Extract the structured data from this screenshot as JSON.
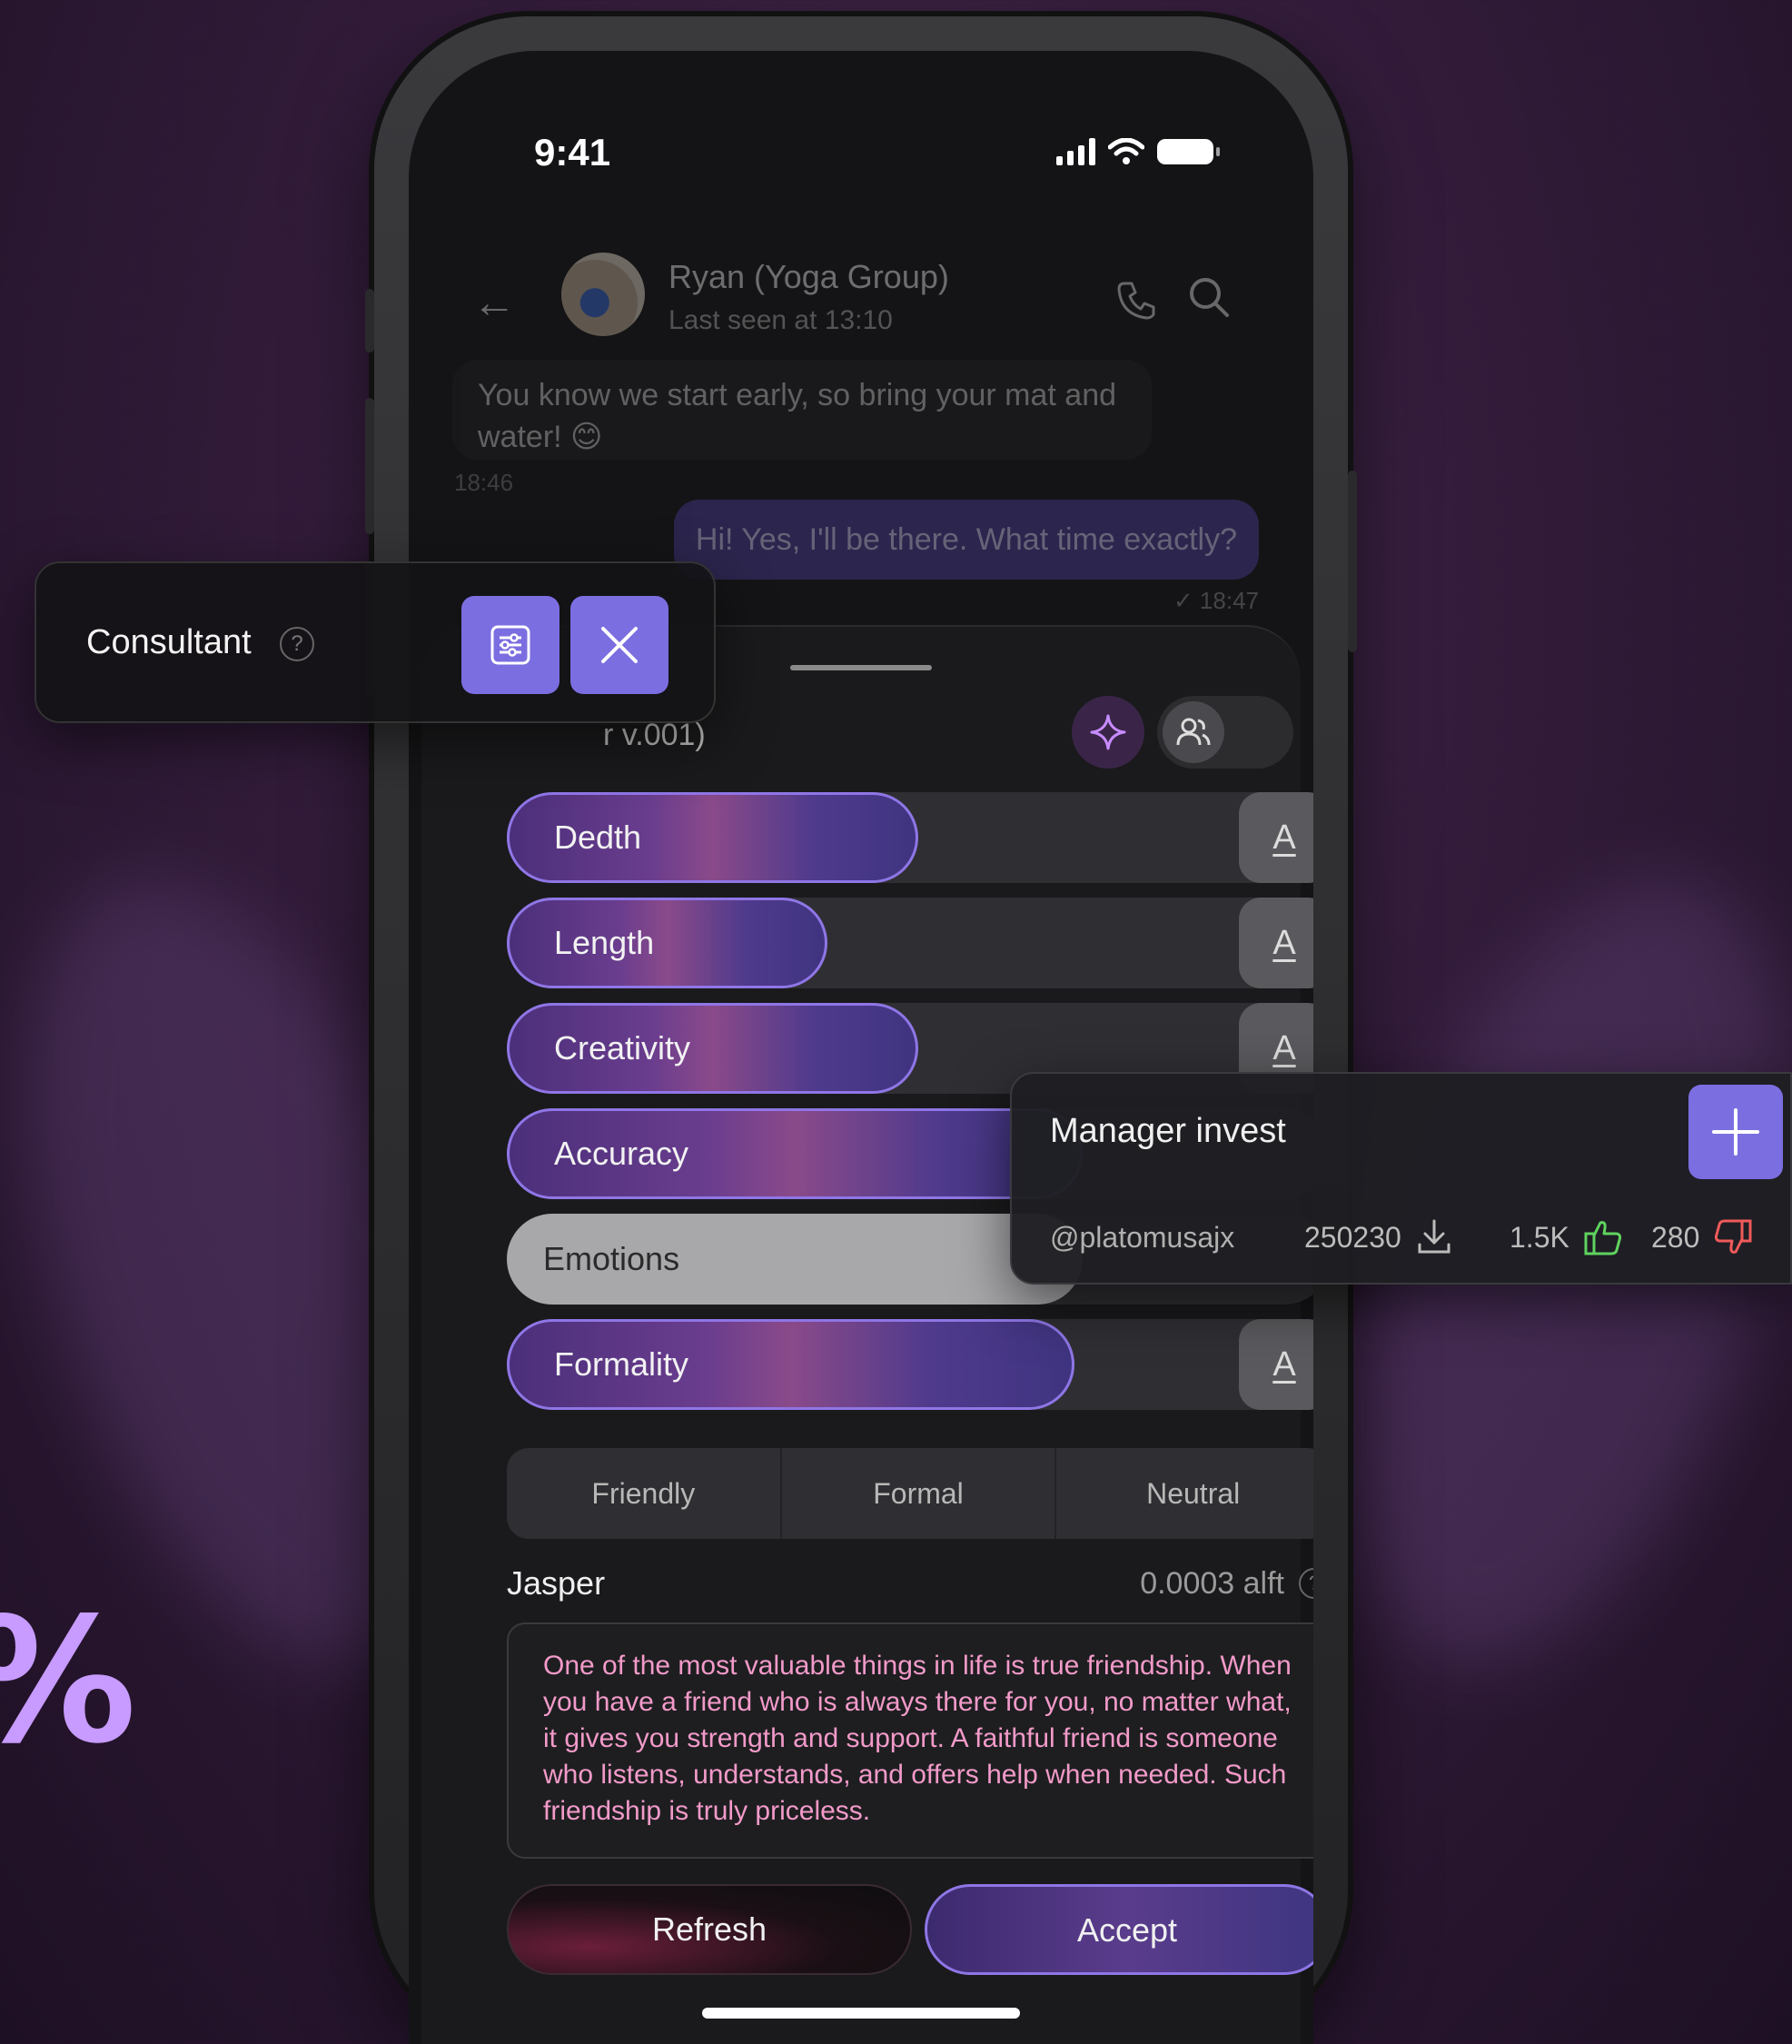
{
  "status_bar": {
    "time": "9:41"
  },
  "chat": {
    "contact_name": "Ryan (Yoga Group)",
    "contact_status": "Last seen at 13:10",
    "incoming_message": "You know we start early, so bring your mat and water! 😊",
    "incoming_time": "18:46",
    "outgoing_message": "Hi! Yes, I'll be there. What time exactly?",
    "outgoing_time": "✓ 18:47"
  },
  "sheet": {
    "title_partial": "r v.001)",
    "sliders": [
      {
        "label": "Dedth",
        "level": 0.5
      },
      {
        "label": "Length",
        "level": 0.39
      },
      {
        "label": "Creativity",
        "level": 0.5
      },
      {
        "label": "Accuracy",
        "level": 0.7
      },
      {
        "label": "Emotions",
        "level": 0.7
      },
      {
        "label": "Formality",
        "level": 0.69
      }
    ],
    "slider_button_letter": "A",
    "tones": [
      "Friendly",
      "Formal",
      "Neutral"
    ],
    "model_name": "Jasper",
    "model_cost": "0.0003 alft",
    "output_text": "One of the most valuable things in life is true friendship. When you have a friend who is always there for you, no matter what, it gives you strength and support. A faithful friend is someone who listens, understands, and offers help when needed. Such friendship is truly priceless.",
    "refresh_label": "Refresh",
    "accept_label": "Accept"
  },
  "consultant_card": {
    "title": "Consultant",
    "help": "?"
  },
  "manager_card": {
    "title": "Manager invest",
    "handle": "@platomusajx",
    "downloads": "250230",
    "likes": "1.5K",
    "dislikes": "280"
  },
  "decor": {
    "percent": "%"
  },
  "colors": {
    "accent": "#7b6ee0",
    "output_text": "#f29ac9",
    "like": "#5fd35f",
    "dislike": "#f05a5a"
  }
}
